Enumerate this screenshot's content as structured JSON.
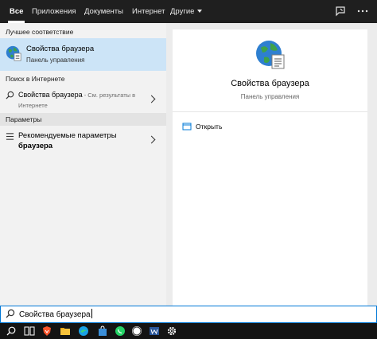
{
  "tabs": {
    "all": "Все",
    "apps": "Приложения",
    "documents": "Документы",
    "internet": "Интернет",
    "other": "Другие"
  },
  "left": {
    "best_match_header": "Лучшее соответствие",
    "best_match": {
      "title": "Свойства браузера",
      "subtitle": "Панель управления"
    },
    "web_header": "Поиск в Интернете",
    "web_result": {
      "query": "Свойства браузера",
      "hint_line1": " - См. результаты в",
      "hint_line2": "Интернете"
    },
    "settings_header": "Параметры",
    "settings_result": {
      "line1": "Рекомендуемые параметры",
      "line2": "браузера"
    }
  },
  "right": {
    "title": "Свойства браузера",
    "subtitle": "Панель управления",
    "open_label": "Открыть"
  },
  "search": {
    "value": "Свойства браузера"
  },
  "colors": {
    "accent": "#0078d7",
    "selected_bg": "#cce4f7",
    "topbar_bg": "#1f1f1f",
    "taskbar_bg": "#141414"
  },
  "icons": {
    "search": "search-icon",
    "feedback": "feedback-icon",
    "more": "more-icon",
    "globe": "internet-options-globe-icon",
    "open": "open-window-icon"
  }
}
